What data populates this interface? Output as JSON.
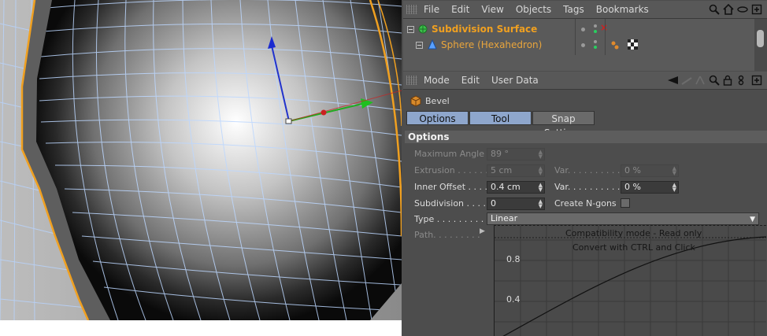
{
  "objects_menu": {
    "items": [
      "File",
      "Edit",
      "View",
      "Objects",
      "Tags",
      "Bookmarks"
    ],
    "icons": [
      "search-icon",
      "home-icon",
      "eye-icon",
      "new-window-icon"
    ]
  },
  "object_manager": {
    "objects": [
      {
        "name": "Subdivision Surface",
        "icon": "subdivision-icon"
      },
      {
        "name": "Sphere (Hexahedron)",
        "icon": "sphere-icon"
      }
    ]
  },
  "attributes_menu": {
    "items": [
      "Mode",
      "Edit",
      "User Data"
    ],
    "icons": [
      "back-arrow-icon",
      "forward-arrow-icon",
      "up-arrow-icon",
      "search-icon",
      "lock-icon",
      "link-icon",
      "new-window-icon"
    ]
  },
  "tool": {
    "name": "Bevel",
    "icon": "bevel-icon",
    "tabs": [
      {
        "label": "Options",
        "active": true
      },
      {
        "label": "Tool",
        "active": true
      },
      {
        "label": "Snap Settings",
        "active": false
      }
    ],
    "section_title": "Options",
    "maximum_angle": {
      "label": "Maximum Angle",
      "value": "89 °",
      "enabled": false
    },
    "extrusion": {
      "label": "Extrusion . . . . . .",
      "value": "5 cm",
      "enabled": false
    },
    "extrusion_var": {
      "label": "Var. . . . . . . . . .",
      "value": "0 %",
      "enabled": false
    },
    "inner_offset": {
      "label": "Inner Offset . . . .",
      "value": "0.4 cm",
      "enabled": true
    },
    "inner_offset_var": {
      "label": "Var. . . . . . . . . .",
      "value": "0 %",
      "enabled": true
    },
    "subdivision": {
      "label": "Subdivision . . . .",
      "value": "0",
      "enabled": true
    },
    "create_ngons": {
      "label": "Create N-gons",
      "checked": false
    },
    "type": {
      "label": "Type . . . . . . . . . .",
      "value": "Linear"
    },
    "path": {
      "label": "Path. . . . . . . . ."
    },
    "graph": {
      "message_line1": "Compatibility mode - Read only",
      "message_line2": "Convert with CTRL and Click",
      "tick_labels": [
        "0.8",
        "0.4"
      ]
    }
  },
  "colors": {
    "accent_orange": "#f0a020",
    "tab_active": "#8ea6cc",
    "panel_bg": "#4d4d4d"
  }
}
